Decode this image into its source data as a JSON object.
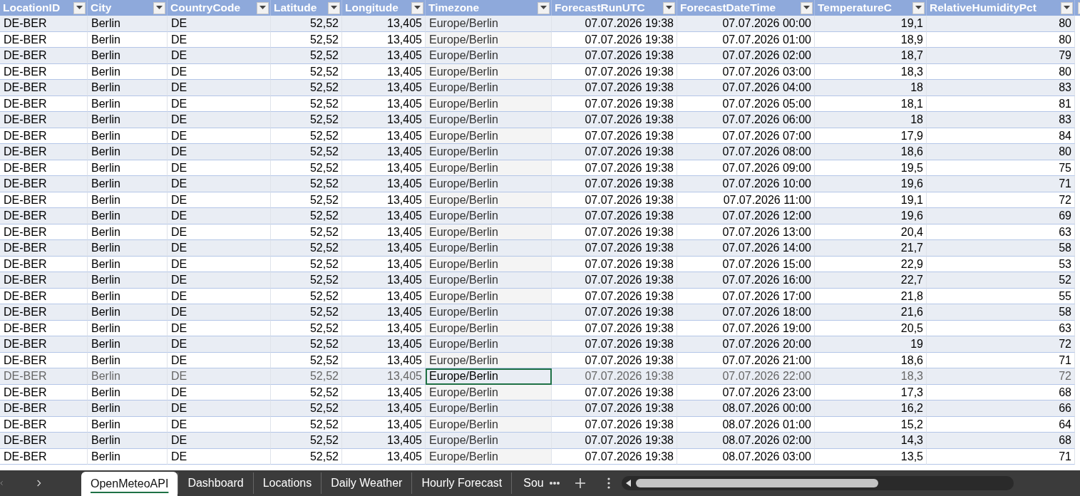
{
  "table": {
    "columns": [
      {
        "label": "LocationID",
        "kind": "text"
      },
      {
        "label": "City",
        "kind": "text"
      },
      {
        "label": "CountryCode",
        "kind": "text"
      },
      {
        "label": "Latitude",
        "kind": "number"
      },
      {
        "label": "Longitude",
        "kind": "number"
      },
      {
        "label": "Timezone",
        "kind": "zone"
      },
      {
        "label": "ForecastRunUTC",
        "kind": "number"
      },
      {
        "label": "ForecastDateTime",
        "kind": "number"
      },
      {
        "label": "TemperatureC",
        "kind": "number"
      },
      {
        "label": "RelativeHumidityPct",
        "kind": "number"
      }
    ],
    "rows": [
      {
        "selected": false,
        "cells": [
          "DE-BER",
          "Berlin",
          "DE",
          "52,52",
          "13,405",
          "Europe/Berlin",
          "07.07.2026 19:38",
          "07.07.2026 00:00",
          "19,1",
          "80"
        ]
      },
      {
        "selected": false,
        "cells": [
          "DE-BER",
          "Berlin",
          "DE",
          "52,52",
          "13,405",
          "Europe/Berlin",
          "07.07.2026 19:38",
          "07.07.2026 01:00",
          "18,9",
          "80"
        ]
      },
      {
        "selected": false,
        "cells": [
          "DE-BER",
          "Berlin",
          "DE",
          "52,52",
          "13,405",
          "Europe/Berlin",
          "07.07.2026 19:38",
          "07.07.2026 02:00",
          "18,7",
          "79"
        ]
      },
      {
        "selected": false,
        "cells": [
          "DE-BER",
          "Berlin",
          "DE",
          "52,52",
          "13,405",
          "Europe/Berlin",
          "07.07.2026 19:38",
          "07.07.2026 03:00",
          "18,3",
          "80"
        ]
      },
      {
        "selected": false,
        "cells": [
          "DE-BER",
          "Berlin",
          "DE",
          "52,52",
          "13,405",
          "Europe/Berlin",
          "07.07.2026 19:38",
          "07.07.2026 04:00",
          "18",
          "83"
        ]
      },
      {
        "selected": false,
        "cells": [
          "DE-BER",
          "Berlin",
          "DE",
          "52,52",
          "13,405",
          "Europe/Berlin",
          "07.07.2026 19:38",
          "07.07.2026 05:00",
          "18,1",
          "81"
        ]
      },
      {
        "selected": false,
        "cells": [
          "DE-BER",
          "Berlin",
          "DE",
          "52,52",
          "13,405",
          "Europe/Berlin",
          "07.07.2026 19:38",
          "07.07.2026 06:00",
          "18",
          "83"
        ]
      },
      {
        "selected": false,
        "cells": [
          "DE-BER",
          "Berlin",
          "DE",
          "52,52",
          "13,405",
          "Europe/Berlin",
          "07.07.2026 19:38",
          "07.07.2026 07:00",
          "17,9",
          "84"
        ]
      },
      {
        "selected": false,
        "cells": [
          "DE-BER",
          "Berlin",
          "DE",
          "52,52",
          "13,405",
          "Europe/Berlin",
          "07.07.2026 19:38",
          "07.07.2026 08:00",
          "18,6",
          "80"
        ]
      },
      {
        "selected": false,
        "cells": [
          "DE-BER",
          "Berlin",
          "DE",
          "52,52",
          "13,405",
          "Europe/Berlin",
          "07.07.2026 19:38",
          "07.07.2026 09:00",
          "19,5",
          "75"
        ]
      },
      {
        "selected": false,
        "cells": [
          "DE-BER",
          "Berlin",
          "DE",
          "52,52",
          "13,405",
          "Europe/Berlin",
          "07.07.2026 19:38",
          "07.07.2026 10:00",
          "19,6",
          "71"
        ]
      },
      {
        "selected": false,
        "cells": [
          "DE-BER",
          "Berlin",
          "DE",
          "52,52",
          "13,405",
          "Europe/Berlin",
          "07.07.2026 19:38",
          "07.07.2026 11:00",
          "19,1",
          "72"
        ]
      },
      {
        "selected": false,
        "cells": [
          "DE-BER",
          "Berlin",
          "DE",
          "52,52",
          "13,405",
          "Europe/Berlin",
          "07.07.2026 19:38",
          "07.07.2026 12:00",
          "19,6",
          "69"
        ]
      },
      {
        "selected": false,
        "cells": [
          "DE-BER",
          "Berlin",
          "DE",
          "52,52",
          "13,405",
          "Europe/Berlin",
          "07.07.2026 19:38",
          "07.07.2026 13:00",
          "20,4",
          "63"
        ]
      },
      {
        "selected": false,
        "cells": [
          "DE-BER",
          "Berlin",
          "DE",
          "52,52",
          "13,405",
          "Europe/Berlin",
          "07.07.2026 19:38",
          "07.07.2026 14:00",
          "21,7",
          "58"
        ]
      },
      {
        "selected": false,
        "cells": [
          "DE-BER",
          "Berlin",
          "DE",
          "52,52",
          "13,405",
          "Europe/Berlin",
          "07.07.2026 19:38",
          "07.07.2026 15:00",
          "22,9",
          "53"
        ]
      },
      {
        "selected": false,
        "cells": [
          "DE-BER",
          "Berlin",
          "DE",
          "52,52",
          "13,405",
          "Europe/Berlin",
          "07.07.2026 19:38",
          "07.07.2026 16:00",
          "22,7",
          "52"
        ]
      },
      {
        "selected": false,
        "cells": [
          "DE-BER",
          "Berlin",
          "DE",
          "52,52",
          "13,405",
          "Europe/Berlin",
          "07.07.2026 19:38",
          "07.07.2026 17:00",
          "21,8",
          "55"
        ]
      },
      {
        "selected": false,
        "cells": [
          "DE-BER",
          "Berlin",
          "DE",
          "52,52",
          "13,405",
          "Europe/Berlin",
          "07.07.2026 19:38",
          "07.07.2026 18:00",
          "21,6",
          "58"
        ]
      },
      {
        "selected": false,
        "cells": [
          "DE-BER",
          "Berlin",
          "DE",
          "52,52",
          "13,405",
          "Europe/Berlin",
          "07.07.2026 19:38",
          "07.07.2026 19:00",
          "20,5",
          "63"
        ]
      },
      {
        "selected": false,
        "cells": [
          "DE-BER",
          "Berlin",
          "DE",
          "52,52",
          "13,405",
          "Europe/Berlin",
          "07.07.2026 19:38",
          "07.07.2026 20:00",
          "19",
          "72"
        ]
      },
      {
        "selected": false,
        "cells": [
          "DE-BER",
          "Berlin",
          "DE",
          "52,52",
          "13,405",
          "Europe/Berlin",
          "07.07.2026 19:38",
          "07.07.2026 21:00",
          "18,6",
          "71"
        ]
      },
      {
        "selected": true,
        "cells": [
          "DE-BER",
          "Berlin",
          "DE",
          "52,52",
          "13,405",
          "Europe/Berlin",
          "07.07.2026 19:38",
          "07.07.2026 22:00",
          "18,3",
          "72"
        ]
      },
      {
        "selected": false,
        "cells": [
          "DE-BER",
          "Berlin",
          "DE",
          "52,52",
          "13,405",
          "Europe/Berlin",
          "07.07.2026 19:38",
          "07.07.2026 23:00",
          "17,3",
          "68"
        ]
      },
      {
        "selected": false,
        "cells": [
          "DE-BER",
          "Berlin",
          "DE",
          "52,52",
          "13,405",
          "Europe/Berlin",
          "07.07.2026 19:38",
          "08.07.2026 00:00",
          "16,2",
          "66"
        ]
      },
      {
        "selected": false,
        "cells": [
          "DE-BER",
          "Berlin",
          "DE",
          "52,52",
          "13,405",
          "Europe/Berlin",
          "07.07.2026 19:38",
          "08.07.2026 01:00",
          "15,2",
          "64"
        ]
      },
      {
        "selected": false,
        "cells": [
          "DE-BER",
          "Berlin",
          "DE",
          "52,52",
          "13,405",
          "Europe/Berlin",
          "07.07.2026 19:38",
          "08.07.2026 02:00",
          "14,3",
          "68"
        ]
      },
      {
        "selected": false,
        "cells": [
          "DE-BER",
          "Berlin",
          "DE",
          "52,52",
          "13,405",
          "Europe/Berlin",
          "07.07.2026 19:38",
          "08.07.2026 03:00",
          "13,5",
          "71"
        ]
      }
    ]
  },
  "sheet_tabs": [
    {
      "label": "OpenMeteoAPI",
      "selected": true
    },
    {
      "label": "Dashboard",
      "selected": false
    },
    {
      "label": "Locations",
      "selected": false
    },
    {
      "label": "Daily Weather",
      "selected": false
    },
    {
      "label": "Hourly Forecast",
      "selected": false
    },
    {
      "label": "Sou",
      "selected": false
    }
  ]
}
